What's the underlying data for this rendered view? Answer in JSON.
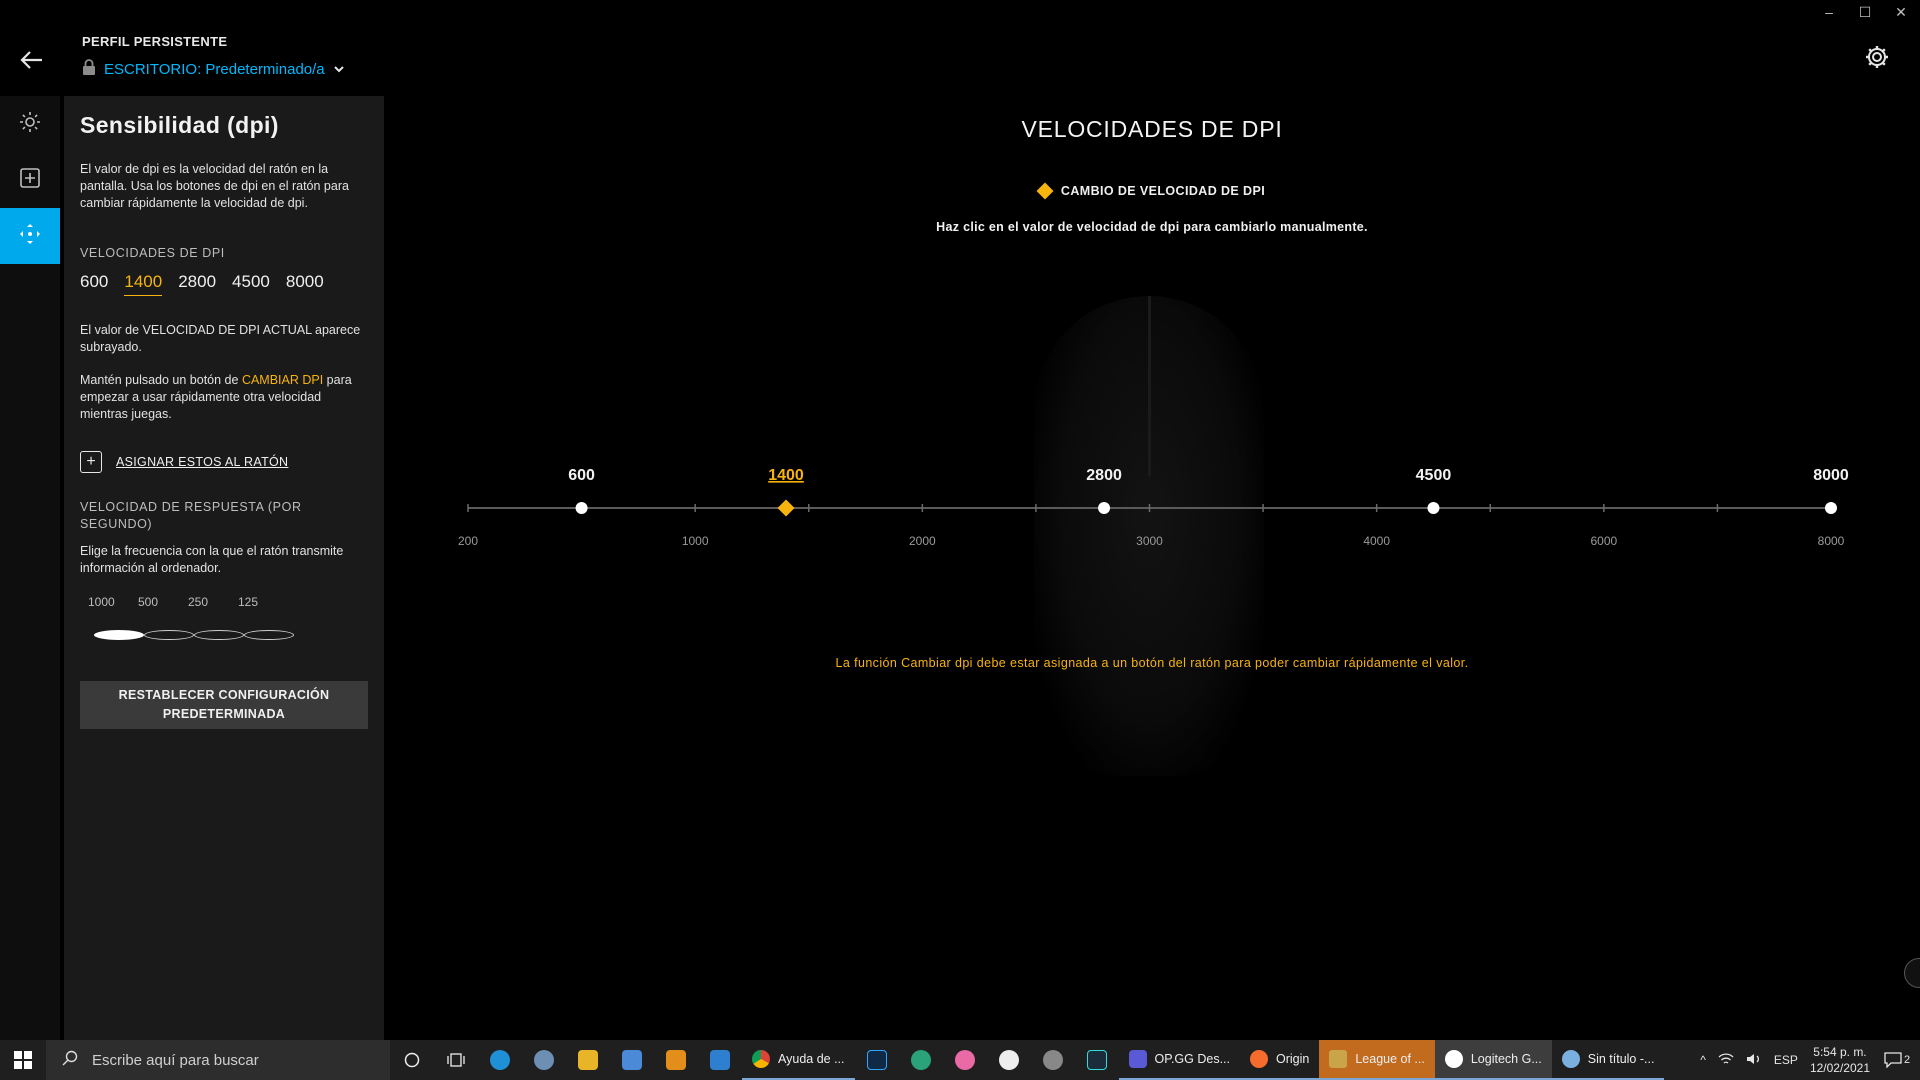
{
  "window": {
    "minimize": "–",
    "maximize": "☐",
    "close": "✕"
  },
  "header": {
    "profile_label": "PERFIL PERSISTENTE",
    "profile_value": "ESCRITORIO: Predeterminado/a"
  },
  "panel": {
    "title": "Sensibilidad (dpi)",
    "description": "El valor de dpi es la velocidad del ratón en la pantalla. Usa los botones de dpi en el ratón para cambiar rápidamente la velocidad de dpi.",
    "dpi_section_title": "VELOCIDADES DE DPI",
    "dpi_values": [
      "600",
      "1400",
      "2800",
      "4500",
      "8000"
    ],
    "current_dpi_index": 1,
    "note_current": "El valor de VELOCIDAD DE DPI ACTUAL aparece subrayado.",
    "note_hold_prefix": "Mantén pulsado un botón de ",
    "note_hold_highlight": "CAMBIAR DPI",
    "note_hold_suffix": " para empezar a usar rápidamente otra velocidad mientras juegas.",
    "assign_label": "ASIGNAR ESTOS AL RATÓN",
    "rate_title": "VELOCIDAD DE RESPUESTA (POR SEGUNDO)",
    "rate_description": "Elige la frecuencia con la que el ratón transmite información al ordenador.",
    "rate_options": [
      "1000",
      "500",
      "250",
      "125"
    ],
    "rate_selected_index": 0,
    "reset_label_line1": "RESTABLECER CONFIGURACIÓN",
    "reset_label_line2": "PREDETERMINADA"
  },
  "main": {
    "title": "VELOCIDADES DE DPI",
    "legend_label": "CAMBIO DE VELOCIDAD DE DPI",
    "hint": "Haz clic en el valor de velocidad de dpi para cambiarlo manualmente.",
    "warning": "La función Cambiar dpi debe estar asignada a un botón del ratón para poder cambiar rápidamente el valor."
  },
  "slider": {
    "scale_ticks": [
      "200",
      "1000",
      "2000",
      "3000",
      "4000",
      "6000",
      "8000"
    ],
    "markers": [
      {
        "label": "600",
        "tick_pos": 0.5,
        "current": false,
        "shift": false
      },
      {
        "label": "1400",
        "tick_pos": 1.4,
        "current": true,
        "shift": true
      },
      {
        "label": "2800",
        "tick_pos": 2.8,
        "current": false,
        "shift": false
      },
      {
        "label": "4500",
        "tick_pos": 4.25,
        "current": false,
        "shift": false
      },
      {
        "label": "8000",
        "tick_pos": 6,
        "current": false,
        "shift": false
      }
    ],
    "accent_color": "#f7b30e"
  },
  "colors": {
    "accent_blue": "#00a8ec",
    "accent_orange": "#f7b30e"
  },
  "taskbar": {
    "search_placeholder": "Escribe aquí para buscar",
    "apps": [
      {
        "label": "Ayuda de ...",
        "icon": "chrome-icon"
      },
      {
        "label": "OP.GG Des...",
        "icon": "opgg-icon"
      },
      {
        "label": "Origin",
        "icon": "origin-icon"
      },
      {
        "label": "League of ...",
        "icon": "league-icon"
      },
      {
        "label": "Logitech G...",
        "icon": "logitech-icon"
      },
      {
        "label": "Sin título -...",
        "icon": "paint-icon"
      }
    ],
    "language": "ESP",
    "time": "5:54 p. m.",
    "date": "12/02/2021",
    "notifications": "2"
  }
}
